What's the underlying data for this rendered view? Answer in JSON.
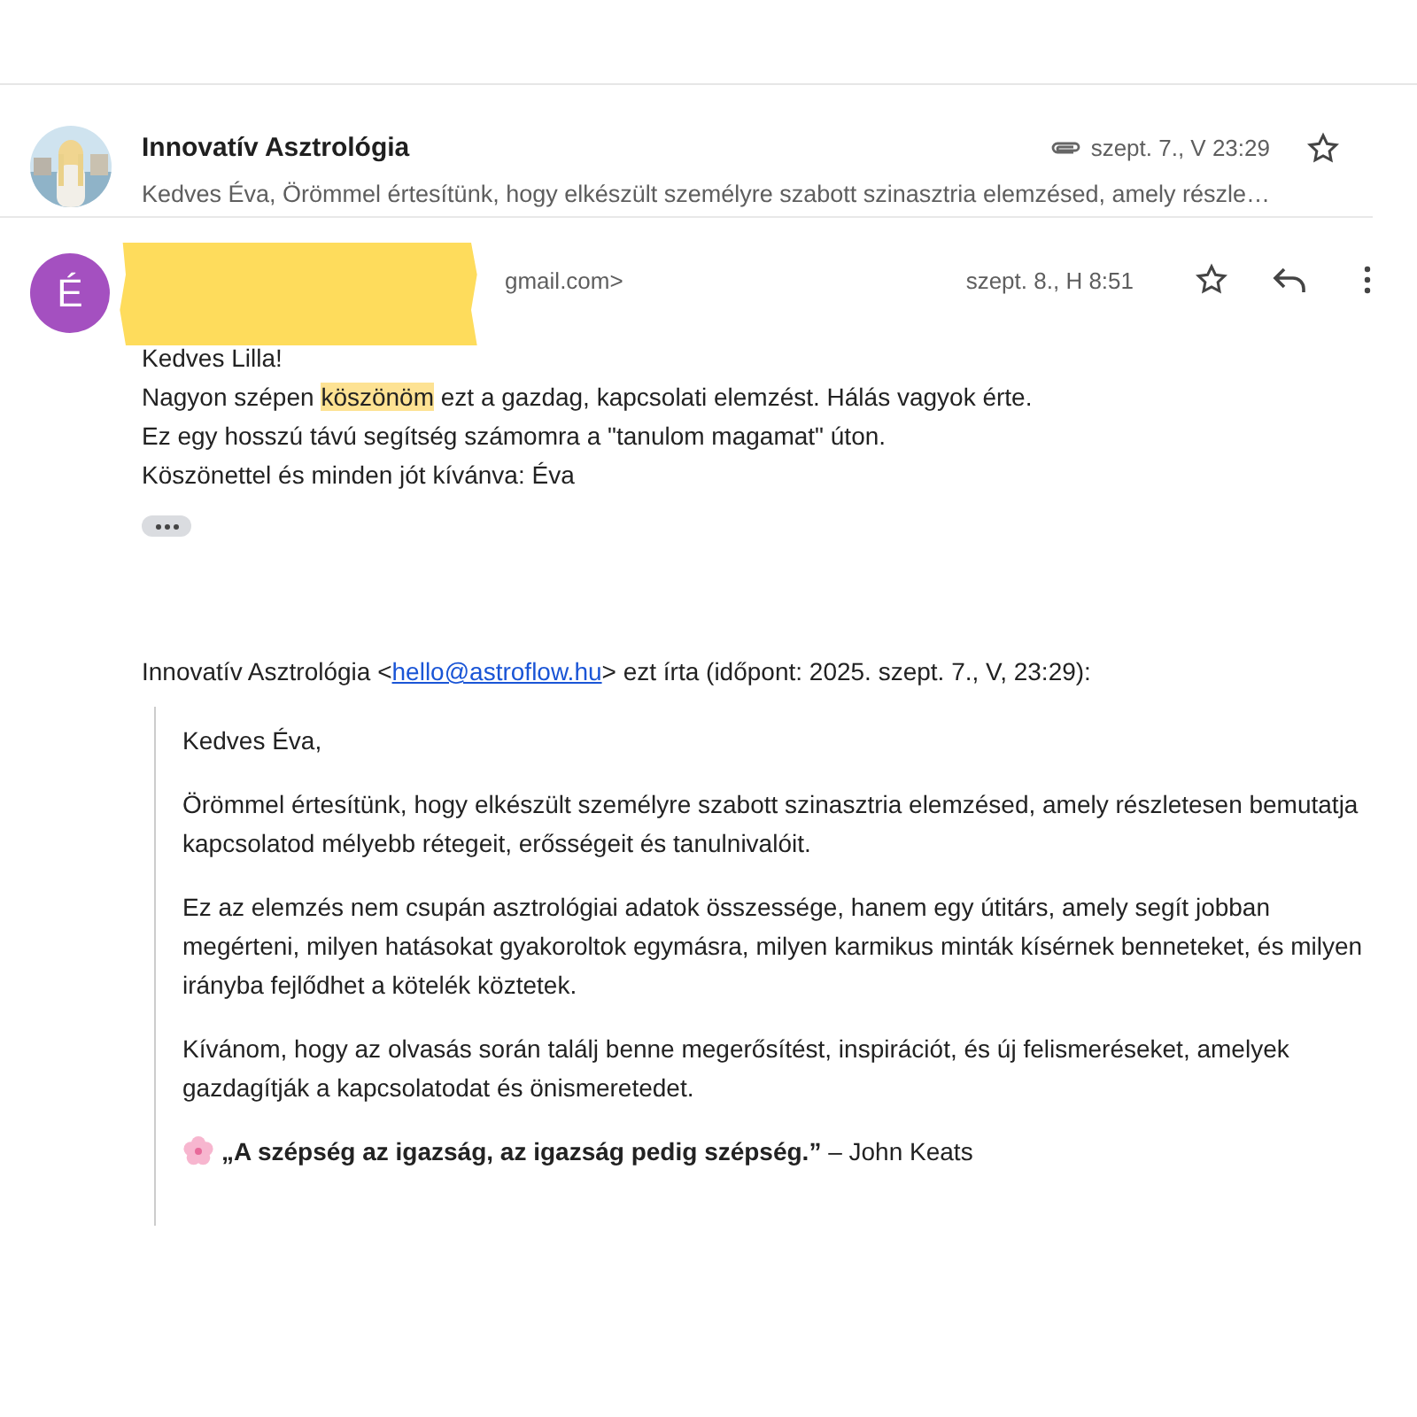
{
  "collapsed_message": {
    "sender": "Innovatív Asztrológia",
    "date": "szept. 7., V 23:29",
    "has_attachment": true,
    "starred": false,
    "snippet": "Kedves Éva, Örömmel értesítünk, hogy elkészült személyre szabott szinasztria elemzésed, amely részle…"
  },
  "open_message": {
    "avatar_letter": "É",
    "sender_visible": "gmail.com>",
    "redacted": true,
    "date": "szept. 8., H 8:51",
    "starred": false,
    "lines": [
      [
        {
          "text": "Kedves Lilla!",
          "highlighted": false
        }
      ],
      [
        {
          "text": "Nagyon szépen ",
          "highlighted": false
        },
        {
          "text": "köszönöm",
          "highlighted": true
        },
        {
          "text": " ezt a gazdag, kapcsolati elemzést. Hálás vagyok érte.",
          "highlighted": false
        }
      ],
      [
        {
          "text": "Ez egy hosszú távú segítség számomra a \"tanulom magamat\" úton.",
          "highlighted": false
        }
      ],
      [
        {
          "text": "Köszönettel és minden jót kívánva: Éva",
          "highlighted": false
        }
      ]
    ],
    "quote_header": {
      "before": "Innovatív Asztrológia <",
      "link": "hello@astroflow.hu",
      "after": "> ezt írta (időpont: 2025. szept. 7., V, 23:29):"
    },
    "quoted": [
      {
        "kind": "text",
        "text": "Kedves Éva,"
      },
      {
        "kind": "text",
        "text": "Örömmel értesítünk, hogy elkészült személyre szabott szinasztria elemzésed, amely részletesen bemutatja kapcsolatod mélyebb rétegeit, erősségeit és tanulnivalóit."
      },
      {
        "kind": "text",
        "text": "Ez az elemzés nem csupán asztrológiai adatok összessége, hanem egy útitárs, amely segít jobban megérteni, milyen hatásokat gyakoroltok egymásra, milyen karmikus minták kísérnek benneteket, és milyen irányba fejlődhet a kötelék köztetek."
      },
      {
        "kind": "text",
        "text": "Kívánom, hogy az olvasás során találj benne megerősítést, inspirációt, és új felismeréseket, amelyek gazdagítják a kapcsolatodat és önismeretedet."
      },
      {
        "kind": "flower",
        "text": "**„A szépség az igazság, az igazság pedig szépség.”** – John Keats"
      }
    ]
  }
}
